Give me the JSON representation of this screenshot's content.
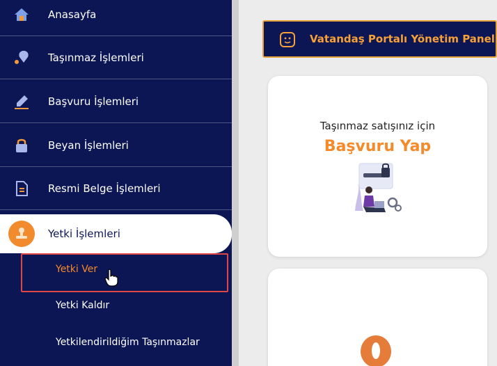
{
  "sidebar": {
    "items": [
      {
        "label": "Anasayfa",
        "icon": "home-icon"
      },
      {
        "label": "Taşınmaz İşlemleri",
        "icon": "map-pin-icon"
      },
      {
        "label": "Başvuru İşlemleri",
        "icon": "pen-icon"
      },
      {
        "label": "Beyan İşlemleri",
        "icon": "lock-icon"
      },
      {
        "label": "Resmi Belge İşlemleri",
        "icon": "document-icon"
      },
      {
        "label": "Yetki İşlemleri",
        "icon": "stamp-icon",
        "active": true
      }
    ],
    "submenu": [
      {
        "label": "Yetki Ver",
        "highlighted": true
      },
      {
        "label": "Yetki Kaldır"
      },
      {
        "label": "Yetkilendirildiğim Taşınmazlar"
      }
    ]
  },
  "main": {
    "portal_title": "Vatandaş Portalı Yönetim Paneli",
    "card1": {
      "subtitle": "Taşınmaz satışınız için",
      "cta": "Başvuru Yap"
    }
  },
  "colors": {
    "sidebar_bg": "#0c1654",
    "accent_orange": "#f58a2a",
    "highlight_border": "#e04646"
  }
}
